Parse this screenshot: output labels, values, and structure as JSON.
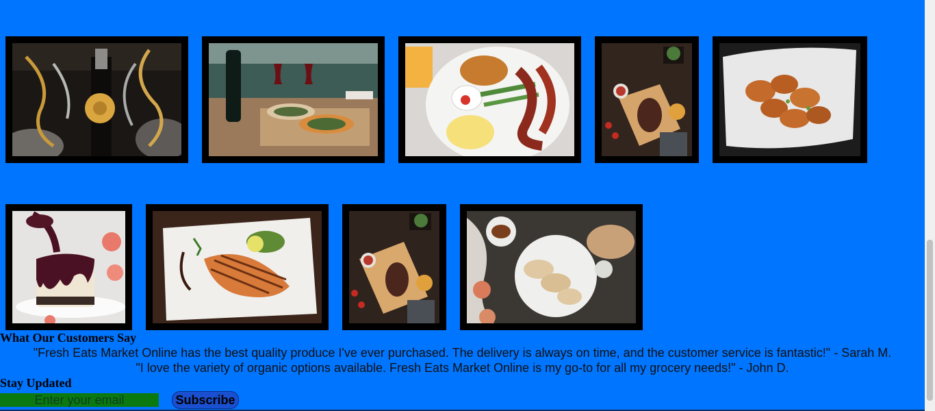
{
  "gallery": {
    "row1": [
      {
        "name": "champagne-photo",
        "subject": "Champagne bottle with gold ribbons"
      },
      {
        "name": "pizza-wine-photo",
        "subject": "Pizzas with red wine"
      },
      {
        "name": "breakfast-plate-photo",
        "subject": "Breakfast plate with bacon and eggs"
      },
      {
        "name": "steak-board-photo",
        "subject": "Steak on wooden board"
      },
      {
        "name": "fried-chicken-photo",
        "subject": "Fried chicken on paper"
      }
    ],
    "row2": [
      {
        "name": "cheesecake-photo",
        "subject": "Cheesecake with berry sauce"
      },
      {
        "name": "grilled-fish-photo",
        "subject": "Grilled fish fillet with lemon"
      },
      {
        "name": "steak-board-photo-2",
        "subject": "Steak on wooden board"
      },
      {
        "name": "bread-table-photo",
        "subject": "Sliced bread on plate"
      }
    ]
  },
  "testimonials": {
    "title": "What Our Customers Say",
    "quotes": [
      "\"Fresh Eats Market Online has the best quality produce I've ever purchased. The delivery is always on time, and the customer service is fantastic!\" - Sarah M.",
      "\"I love the variety of organic options available. Fresh Eats Market Online is my go-to for all my grocery needs!\" - John D."
    ]
  },
  "newsletter": {
    "title": "Stay Updated",
    "email_placeholder": "Enter your email",
    "subscribe_label": "Subscribe"
  },
  "colors": {
    "page_background": "#0075ff",
    "input_background": "#0a7a10",
    "button_background": "#1a4fd0"
  }
}
